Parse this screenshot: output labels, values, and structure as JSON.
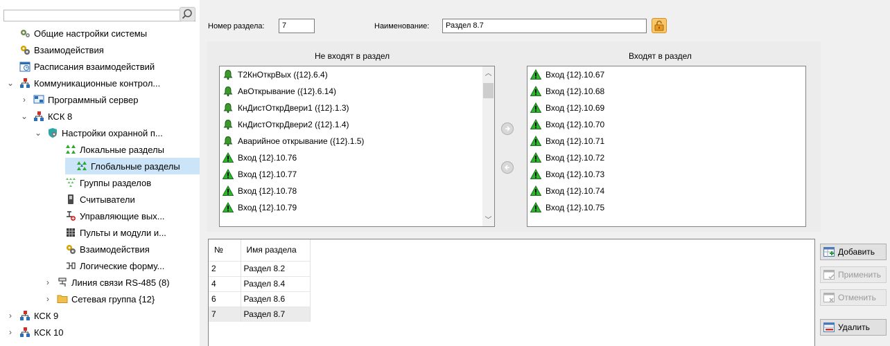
{
  "tree": {
    "items": [
      {
        "label": "Общие настройки системы",
        "icon": "gear-icon",
        "chevron": ""
      },
      {
        "label": "Взаимодействия",
        "icon": "interactions-icon",
        "chevron": ""
      },
      {
        "label": "Расписания взаимодействий",
        "icon": "schedule-icon",
        "chevron": ""
      },
      {
        "label": "Коммуникационные контрол...",
        "icon": "network-icon",
        "chevron": "⌄"
      },
      {
        "label": "Программный сервер",
        "icon": "server-icon",
        "chevron": "›"
      },
      {
        "label": "КСК 8",
        "icon": "network-icon",
        "chevron": "⌄"
      },
      {
        "label": "Настройки охранной п...",
        "icon": "security-settings-icon",
        "chevron": "⌄"
      },
      {
        "label": "Локальные разделы",
        "icon": "local-partitions-icon",
        "chevron": ""
      },
      {
        "label": "Глобальные разделы",
        "icon": "global-partitions-icon",
        "chevron": ""
      },
      {
        "label": "Группы разделов",
        "icon": "partition-groups-icon",
        "chevron": ""
      },
      {
        "label": "Считыватели",
        "icon": "reader-icon",
        "chevron": ""
      },
      {
        "label": "Управляющие вых...",
        "icon": "control-output-icon",
        "chevron": ""
      },
      {
        "label": "Пульты и модули и...",
        "icon": "consoles-icon",
        "chevron": ""
      },
      {
        "label": "Взаимодействия",
        "icon": "interactions-icon",
        "chevron": ""
      },
      {
        "label": "Логические форму...",
        "icon": "logic-formula-icon",
        "chevron": ""
      },
      {
        "label": "Линия связи RS-485 (8)",
        "icon": "rs485-line-icon",
        "chevron": "›"
      },
      {
        "label": "Сетевая группа {12}",
        "icon": "folder-icon",
        "chevron": "›"
      },
      {
        "label": "КСК 9",
        "icon": "network-icon",
        "chevron": "›"
      },
      {
        "label": "КСК 10",
        "icon": "network-icon",
        "chevron": "›"
      }
    ]
  },
  "form": {
    "number_label": "Номер раздела:",
    "number_value": "7",
    "name_label": "Наименование:",
    "name_value": "Раздел 8.7"
  },
  "lists": {
    "left_header": "Не входят в раздел",
    "right_header": "Входят в раздел",
    "left_items": [
      {
        "label": "Т2КнОткрВых ({12}.6.4)",
        "icon": "bell-icon"
      },
      {
        "label": "АвОткрывание ({12}.6.14)",
        "icon": "bell-icon"
      },
      {
        "label": "КнДистОткрДвери1 ({12}.1.3)",
        "icon": "bell-icon"
      },
      {
        "label": "КнДистОткрДвери2 ({12}.1.4)",
        "icon": "bell-icon"
      },
      {
        "label": "Аварийное открывание ({12}.1.5)",
        "icon": "bell-icon"
      },
      {
        "label": "Вход {12}.10.76",
        "icon": "warning-icon"
      },
      {
        "label": "Вход {12}.10.77",
        "icon": "warning-icon"
      },
      {
        "label": "Вход {12}.10.78",
        "icon": "warning-icon"
      },
      {
        "label": "Вход {12}.10.79",
        "icon": "warning-icon"
      }
    ],
    "right_items": [
      {
        "label": "Вход {12}.10.67",
        "icon": "warning-icon"
      },
      {
        "label": "Вход {12}.10.68",
        "icon": "warning-icon"
      },
      {
        "label": "Вход {12}.10.69",
        "icon": "warning-icon"
      },
      {
        "label": "Вход {12}.10.70",
        "icon": "warning-icon"
      },
      {
        "label": "Вход {12}.10.71",
        "icon": "warning-icon"
      },
      {
        "label": "Вход {12}.10.72",
        "icon": "warning-icon"
      },
      {
        "label": "Вход {12}.10.73",
        "icon": "warning-icon"
      },
      {
        "label": "Вход {12}.10.74",
        "icon": "warning-icon"
      },
      {
        "label": "Вход {12}.10.75",
        "icon": "warning-icon"
      }
    ]
  },
  "table": {
    "columns": [
      "№",
      "Имя раздела"
    ],
    "rows": [
      [
        "2",
        "Раздел 8.2"
      ],
      [
        "4",
        "Раздел 8.4"
      ],
      [
        "6",
        "Раздел 8.6"
      ],
      [
        "7",
        "Раздел 8.7"
      ]
    ]
  },
  "buttons": {
    "add": "Добавить",
    "apply": "Применить",
    "cancel": "Отменить",
    "delete": "Удалить"
  },
  "colors": {
    "selection": "#cce4f7",
    "panel_bg": "#f0f0f0",
    "warning_green": "#2fb62f",
    "bell_green": "#1f8a1f"
  }
}
